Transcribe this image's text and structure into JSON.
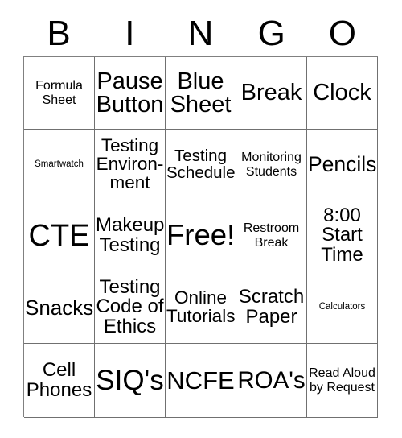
{
  "card": {
    "title": "BINGO",
    "header_letters": [
      "B",
      "I",
      "N",
      "G",
      "O"
    ],
    "rows": 5,
    "columns": 5,
    "free_space": "Free!",
    "colors": {
      "text": "#000000",
      "background": "#ffffff",
      "grid_line": "#707070"
    },
    "cells": [
      [
        {
          "text": "Formula Sheet",
          "size": "s"
        },
        {
          "text": "Pause Button",
          "size": "xl"
        },
        {
          "text": "Blue Sheet",
          "size": "xl"
        },
        {
          "text": "Break",
          "size": "xl"
        },
        {
          "text": "Clock",
          "size": "xl"
        }
      ],
      [
        {
          "text": "Smartwatch",
          "size": "xs"
        },
        {
          "text": "Testing Environ-ment",
          "size": "l"
        },
        {
          "text": "Testing Schedule",
          "size": "l"
        },
        {
          "text": "Monitoring Students",
          "size": "s"
        },
        {
          "text": "Pencils",
          "size": "xl"
        }
      ],
      [
        {
          "text": "CTE",
          "size": "xxl"
        },
        {
          "text": "Makeup Testing",
          "size": "l"
        },
        {
          "text": "Free!",
          "size": "xxl"
        },
        {
          "text": "Restroom Break",
          "size": "s"
        },
        {
          "text": "8:00 Start Time",
          "size": "l"
        }
      ],
      [
        {
          "text": "Snacks",
          "size": "xl"
        },
        {
          "text": "Testing Code of Ethics",
          "size": "l"
        },
        {
          "text": "Online Tutorials",
          "size": "l"
        },
        {
          "text": "Scratch Paper",
          "size": "l"
        },
        {
          "text": "Calculators",
          "size": "xs"
        }
      ],
      [
        {
          "text": "Cell Phones",
          "size": "l"
        },
        {
          "text": "SIQ's",
          "size": "xxl"
        },
        {
          "text": "NCFE",
          "size": "xxl"
        },
        {
          "text": "ROA's",
          "size": "xxl"
        },
        {
          "text": "Read Aloud by Request",
          "size": "s"
        }
      ]
    ]
  }
}
